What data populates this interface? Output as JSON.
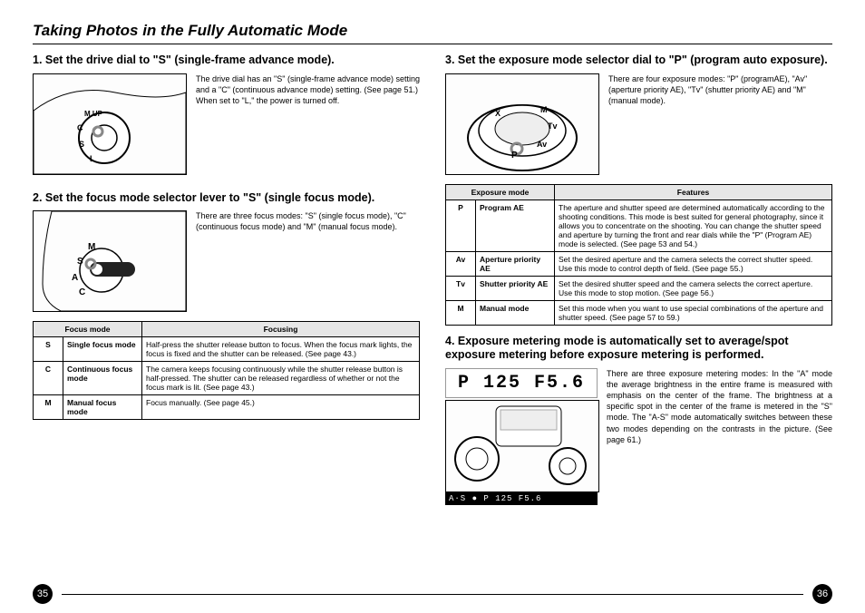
{
  "title": "Taking Photos in the Fully Automatic Mode",
  "page_left": "35",
  "page_right": "36",
  "step1": {
    "heading": "1. Set the drive dial to \"S\" (single-frame advance mode).",
    "body": "The drive dial has an \"S\" (single-frame advance mode) setting and a \"C\" (continuous advance mode) setting. (See page 51.)\nWhen set to \"L,\" the power is turned off.",
    "dial_labels": {
      "mup": "M.UP",
      "c": "C",
      "s": "S",
      "l": "L"
    }
  },
  "step2": {
    "heading": "2. Set the focus mode selector lever to \"S\" (single focus mode).",
    "body": "There are three focus modes: \"S\" (single focus mode), \"C\" (continuous focus mode) and \"M\" (manual focus mode).",
    "lever_labels": {
      "m": "M",
      "s": "S",
      "a": "A",
      "c": "C"
    },
    "table": {
      "h1": "Focus mode",
      "h2": "Focusing",
      "rows": [
        {
          "code": "S",
          "mode": "Single focus mode",
          "desc": "Half-press the shutter release button to focus. When the focus mark lights, the focus is fixed and the shutter can be released. (See page 43.)"
        },
        {
          "code": "C",
          "mode": "Continuous focus mode",
          "desc": "The camera keeps focusing continuously while the shutter release button is half-pressed. The shutter can be released regardless of whether or not the focus mark is lit. (See page 43.)"
        },
        {
          "code": "M",
          "mode": "Manual focus mode",
          "desc": "Focus manually.  (See page 45.)"
        }
      ]
    }
  },
  "step3": {
    "heading": "3. Set the exposure mode selector dial to \"P\" (program auto exposure).",
    "body": "There are four exposure modes: \"P\" (programAE), \"Av\" (aperture priority AE), \"Tv\" (shutter priority AE) and \"M\" (manual mode).",
    "dial_labels": {
      "x": "X",
      "p": "P",
      "av": "Av",
      "tv": "Tv",
      "m": "M"
    },
    "table": {
      "h1": "Exposure mode",
      "h2": "Features",
      "rows": [
        {
          "code": "P",
          "mode": "Program AE",
          "desc": "The aperture and shutter speed are determined automatically according to the shooting conditions. This mode is best suited for general photography, since it allows you to concentrate on the shooting. You can change the shutter speed and aperture by turning the front and rear dials while the \"P\" (Program AE) mode is selected. (See page 53 and 54.)"
        },
        {
          "code": "Av",
          "mode": "Aperture priority AE",
          "desc": "Set the desired aperture and the camera selects the correct shutter speed. Use this mode to control depth of field. (See page 55.)"
        },
        {
          "code": "Tv",
          "mode": "Shutter priority AE",
          "desc": "Set the desired shutter speed and the camera selects the correct aperture. Use this mode to stop motion. (See page 56.)"
        },
        {
          "code": "M",
          "mode": "Manual mode",
          "desc": "Set this mode when you want to use special combinations of the aperture and shutter speed. (See page 57 to 59.)"
        }
      ]
    }
  },
  "step4": {
    "heading": "4.  Exposure metering mode is automatically set to average/spot exposure metering before exposure metering is performed.",
    "body": "There are three exposure metering modes: In the \"A\" mode the average brightness in the entire frame is measured with emphasis on the center of the frame. The brightness at a specific spot in the center of the frame is metered in the \"S\" mode. The \"A-S\" mode automatically switches between these two modes depending on the contrasts in the picture.  (See page 61.)",
    "lcd_top": "P 125  F5.6",
    "lcd_bottom": "A·S ●   P   125  F5.6"
  }
}
